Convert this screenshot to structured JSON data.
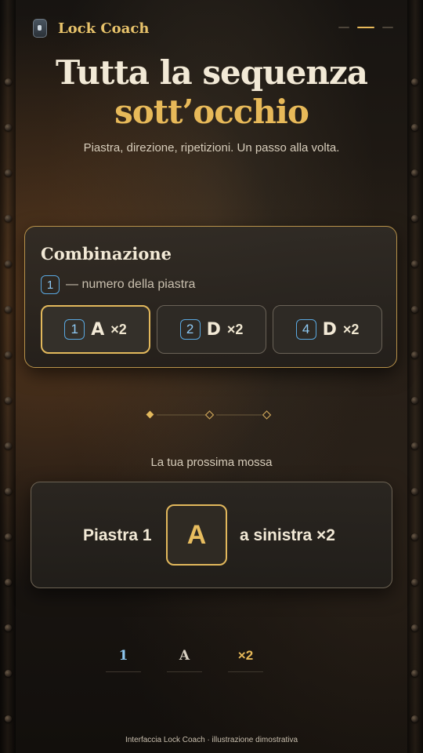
{
  "app": {
    "name": "Lock Coach"
  },
  "progress": {
    "total_steps": 3,
    "current_step": 2
  },
  "hero": {
    "title_line1": "Tutta la sequenza",
    "title_line2": "sott’occhio",
    "subtitle": "Piastra, direzione, ripetizioni. Un passo alla volta."
  },
  "combination": {
    "title": "Combinazione",
    "legend_number": "1",
    "legend_text": "— numero della piastra",
    "items": [
      {
        "plate": "1",
        "direction": "A",
        "times": "×2",
        "active": true
      },
      {
        "plate": "2",
        "direction": "D",
        "times": "×2",
        "active": false
      },
      {
        "plate": "4",
        "direction": "D",
        "times": "×2",
        "active": false
      }
    ]
  },
  "next_move": {
    "label": "La tua prossima mossa",
    "plate_text": "Piastra 1",
    "letter": "A",
    "direction_text": "a sinistra ×2"
  },
  "tokens": [
    "1",
    "A",
    "×2"
  ],
  "footer": "Interfaccia Lock Coach · illustrazione dimostrativa",
  "colors": {
    "accent": "#e2b85c",
    "plate_blue": "#5aa8e0",
    "text": "#f2e9d6"
  }
}
